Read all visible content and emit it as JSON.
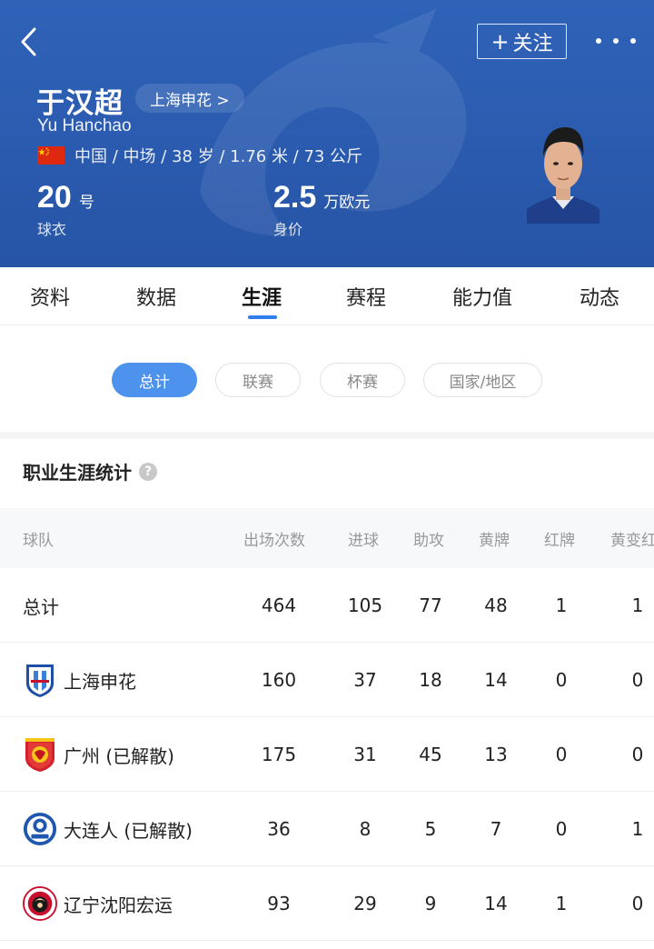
{
  "header": {
    "follow_label": "关注",
    "player_name": "于汉超",
    "club_link": "上海申花 >",
    "player_name_en": "Yu Hanchao",
    "player_info": "中国 / 中场 / 38 岁 / 1.76 米 / 73 公斤",
    "shirt_number": "20",
    "shirt_unit": "号",
    "shirt_caption": "球衣",
    "market_value": "2.5",
    "market_value_unit": "万欧元",
    "market_value_caption": "身价",
    "brand_color": "#2c5cae",
    "flag_color": "#de2910"
  },
  "tabs": [
    {
      "label": "资料"
    },
    {
      "label": "数据"
    },
    {
      "label": "生涯"
    },
    {
      "label": "赛程"
    },
    {
      "label": "能力值"
    },
    {
      "label": "动态"
    }
  ],
  "active_tab": "生涯",
  "filters": [
    {
      "label": "总计",
      "selected": true
    },
    {
      "label": "联赛",
      "selected": false
    },
    {
      "label": "杯赛",
      "selected": false
    },
    {
      "label": "国家/地区",
      "selected": false
    }
  ],
  "section_title": "职业生涯统计",
  "table": {
    "columns": [
      "球队",
      "出场次数",
      "进球",
      "助攻",
      "黄牌",
      "红牌",
      "黄变红"
    ],
    "rows": [
      {
        "team": "总计",
        "apps": "464",
        "goals": "105",
        "assists": "77",
        "yellow": "48",
        "red": "1",
        "yellow_red": "1",
        "logo": "none"
      },
      {
        "team": "上海申花",
        "apps": "160",
        "goals": "37",
        "assists": "18",
        "yellow": "14",
        "red": "0",
        "yellow_red": "0",
        "logo": "shenhua-logo"
      },
      {
        "team": "广州 (已解散)",
        "apps": "175",
        "goals": "31",
        "assists": "45",
        "yellow": "13",
        "red": "0",
        "yellow_red": "0",
        "logo": "guangzhou-logo"
      },
      {
        "team": "大连人 (已解散)",
        "apps": "36",
        "goals": "8",
        "assists": "5",
        "yellow": "7",
        "red": "0",
        "yellow_red": "1",
        "logo": "dalian-logo"
      },
      {
        "team": "辽宁沈阳宏运",
        "apps": "93",
        "goals": "29",
        "assists": "9",
        "yellow": "14",
        "red": "1",
        "yellow_red": "0",
        "logo": "liaoning-logo"
      }
    ]
  }
}
